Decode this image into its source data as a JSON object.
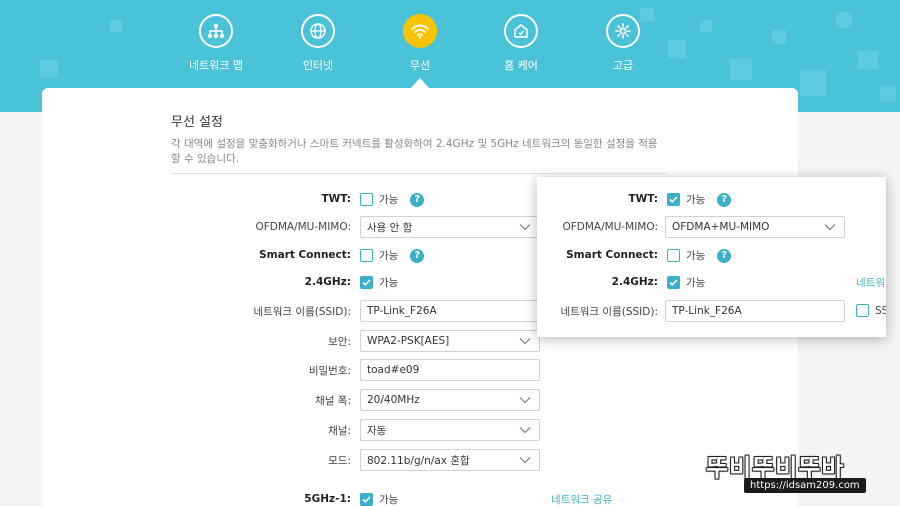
{
  "nav": {
    "items": [
      {
        "label": "네트워크 맵",
        "icon": "network-map-icon"
      },
      {
        "label": "인터넷",
        "icon": "globe-icon"
      },
      {
        "label": "무선",
        "icon": "wifi-icon",
        "active": true
      },
      {
        "label": "홈 케어",
        "icon": "home-care-icon"
      },
      {
        "label": "고급",
        "icon": "gear-icon"
      }
    ]
  },
  "section": {
    "title": "무선 설정",
    "description": "각 대역에 설정을 맞춤화하거나 스마트 커넥트를 활성화하여 2.4GHz 및 5GHz 네트워크의 동일한 설정을 적용할 수 있습니다."
  },
  "form": {
    "twt": {
      "label": "TWT",
      "check_label": "가능",
      "checked": false
    },
    "ofdma": {
      "label": "OFDMA/MU-MIMO",
      "value": "사용 안 함"
    },
    "smart_connect": {
      "label": "Smart Connect",
      "check_label": "가능",
      "checked": false
    },
    "band24": {
      "label": "2.4GHz",
      "check_label": "가능",
      "checked": true
    },
    "ssid": {
      "label": "네트워크 이름(SSID)",
      "value": "TP-Link_F26A"
    },
    "security": {
      "label": "보안",
      "value": "WPA2-PSK[AES]"
    },
    "password": {
      "label": "비밀번호",
      "value": "toad#e09"
    },
    "width": {
      "label": "채널 폭",
      "value": "20/40MHz"
    },
    "channel": {
      "label": "채널",
      "value": "자동"
    },
    "mode": {
      "label": "모드",
      "value": "802.11b/g/n/ax 혼합"
    },
    "band5": {
      "label": "5GHz-1",
      "check_label": "가능",
      "checked": true,
      "link": "네트워크 공유"
    }
  },
  "popup": {
    "twt": {
      "label": "TWT",
      "check_label": "가능",
      "checked": true
    },
    "ofdma": {
      "label": "OFDMA/MU-MIMO",
      "value": "OFDMA+MU-MIMO"
    },
    "smart_connect": {
      "label": "Smart Connect",
      "check_label": "가능",
      "checked": false
    },
    "band24": {
      "label": "2.4GHz",
      "check_label": "가능",
      "checked": true,
      "link_partial": "네트워"
    },
    "ssid": {
      "label": "네트워크 이름(SSID)",
      "value": "TP-Link_F26A",
      "side_partial": "SS"
    }
  },
  "watermark": {
    "title": "뚜비뚜비뚜바",
    "url": "https://idsam209.com"
  },
  "colors": {
    "header": "#4ac3d8",
    "accent": "#3cb0c8",
    "active_nav": "#f6c400"
  }
}
